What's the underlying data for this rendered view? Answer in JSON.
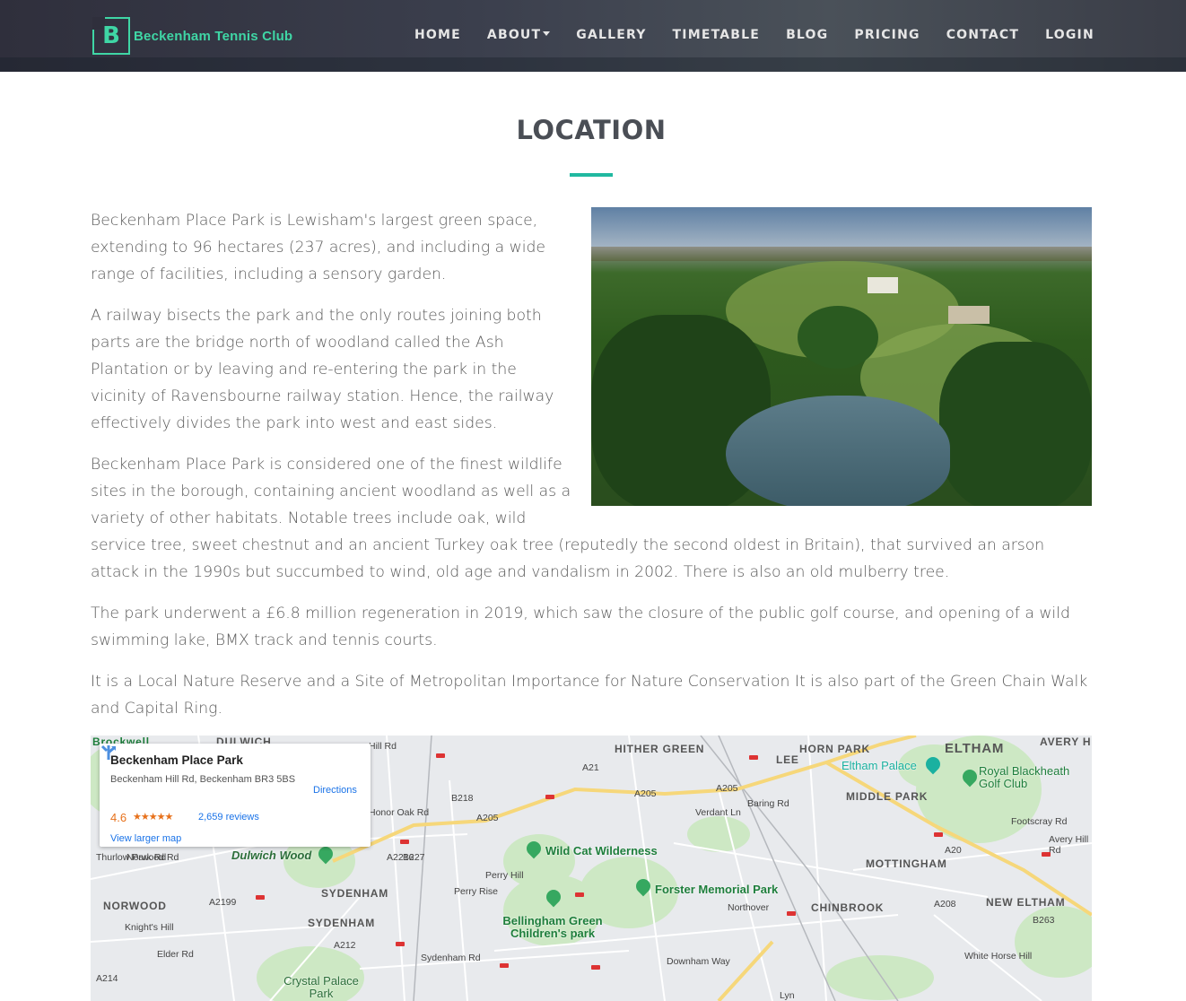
{
  "brand": {
    "letter": "B",
    "name": "Beckenham Tennis Club"
  },
  "nav": {
    "items": [
      "HOME",
      "ABOUT",
      "GALLERY",
      "TIMETABLE",
      "BLOG",
      "PRICING",
      "CONTACT",
      "LOGIN"
    ]
  },
  "page": {
    "title": "LOCATION"
  },
  "content": {
    "paragraphs": [
      "Beckenham Place Park is Lewisham's largest green space, extending to 96 hectares (237 acres), and including a wide range of facilities, including a sensory garden.",
      "A railway bisects the park and the only routes joining both parts are the bridge north of woodland called the Ash Plantation or by leaving and re-entering the park in the vicinity of Ravensbourne railway station. Hence, the railway effectively divides the park into west and east sides.",
      "Beckenham Place Park is considered one of the finest wildlife sites in the borough, containing ancient woodland as well as a variety of other habitats. Notable trees include oak, wild service tree, sweet chestnut and an ancient Turkey oak tree (reputedly the second oldest in Britain), that survived an arson attack in the 1990s but succumbed to wind, old age and vandalism in 2002. There is also an old mulberry tree.",
      "The park underwent a £6.8 million regeneration in 2019, which saw the closure of the public golf course, and opening of a wild swimming lake, BMX track and tennis courts.",
      "It is a Local Nature Reserve and a Site of Metropolitan Importance for Nature Conservation It is also part of the Green Chain Walk and Capital Ring."
    ]
  },
  "map": {
    "info": {
      "title": "Beckenham Place Park",
      "address": "Beckenham Hill Rd, Beckenham BR3 5BS",
      "rating": "4.6",
      "stars": "★★★★★",
      "reviews": "2,659 reviews",
      "larger_map": "View larger map",
      "directions": "Directions"
    },
    "areas": [
      "HITHER GREEN",
      "HORN PARK",
      "ELTHAM",
      "AVERY H",
      "LEE",
      "MIDDLE PARK",
      "MOTTINGHAM",
      "NEW ELTHAM",
      "CHINBROOK",
      "SYDENHAM",
      "SYDENHAM",
      "NORWOOD",
      "DULWICH",
      "Brockwell"
    ],
    "parks": [
      "Eltham Palace",
      "Royal Blackheath Golf Club",
      "Wild Cat Wilderness",
      "Forster Memorial Park",
      "Bellingham Green Children's park",
      "Dulwich Wood",
      "Crystal Palace Park"
    ],
    "roads": [
      "A205",
      "A205",
      "A205",
      "A20",
      "A21",
      "A212",
      "A214",
      "A2199",
      "A2216",
      "B227",
      "B218",
      "A208",
      "B263",
      "Sydenham Rd",
      "Downham Way",
      "Perry Rise",
      "Perry Hill",
      "Verdant Ln",
      "Baring Rd",
      "Footscray Rd",
      "Avery Hill Rd",
      "White Horse Hill",
      "Northover",
      "Honor Oak Rd",
      "Knight's Hill",
      "Norwood Rd",
      "Elder Rd",
      "Thurlow Park Rd",
      "Hill Rd",
      "Lyn"
    ],
    "colors": {
      "land": "#e8eaed",
      "park": "#cde8c4",
      "water": "#aadaff",
      "major_road": "#f6d77a",
      "rail_station": "#d93025"
    }
  }
}
